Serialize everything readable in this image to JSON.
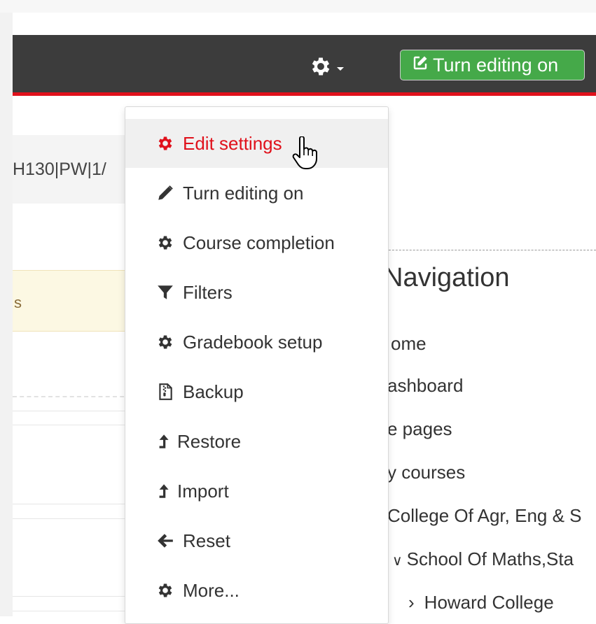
{
  "navbar": {
    "gear_icon": "gear-icon",
    "edit_button_label": "Turn editing on"
  },
  "course": {
    "code_fragment": "H130|PW|1/"
  },
  "notice": {
    "fragment": "s"
  },
  "navigation": {
    "title": "Navigation",
    "items": [
      {
        "label": "ome"
      },
      {
        "label": "ashboard"
      },
      {
        "label": "e pages"
      },
      {
        "label": "y courses"
      },
      {
        "label": "College Of Agr, Eng & S"
      },
      {
        "label": "School Of Maths,Sta"
      },
      {
        "label": "Howard College"
      }
    ]
  },
  "dropdown": {
    "items": [
      {
        "label": "Edit settings",
        "icon": "gear-icon",
        "active": true
      },
      {
        "label": "Turn editing on",
        "icon": "pencil-icon"
      },
      {
        "label": "Course completion",
        "icon": "gear-icon"
      },
      {
        "label": "Filters",
        "icon": "filter-icon"
      },
      {
        "label": "Gradebook setup",
        "icon": "gear-icon"
      },
      {
        "label": "Backup",
        "icon": "file-archive-icon"
      },
      {
        "label": "Restore",
        "icon": "level-up-icon"
      },
      {
        "label": "Import",
        "icon": "level-up-icon"
      },
      {
        "label": "Reset",
        "icon": "arrow-left-icon"
      },
      {
        "label": "More...",
        "icon": "gear-icon"
      }
    ]
  },
  "colors": {
    "navbar_bg": "#3c3c3c",
    "accent_red": "#e0111b",
    "edit_button_green": "#45a949",
    "notice_bg": "#fcf8e3"
  }
}
